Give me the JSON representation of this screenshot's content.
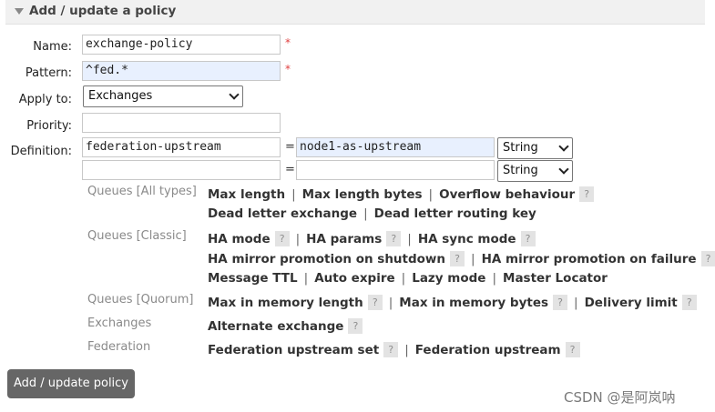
{
  "section": {
    "title": "Add / update a policy"
  },
  "form": {
    "name_label": "Name:",
    "name_value": "exchange-policy",
    "pattern_label": "Pattern:",
    "pattern_value": "^fed.*",
    "apply_to_label": "Apply to:",
    "apply_to_value": "Exchanges",
    "priority_label": "Priority:",
    "priority_value": "",
    "definition_label": "Definition:",
    "required_mark": "*",
    "equals": "=",
    "definitions": [
      {
        "key": "federation-upstream",
        "value": "node1-as-upstream",
        "type": "String"
      },
      {
        "key": "",
        "value": "",
        "type": "String"
      }
    ]
  },
  "help_mark": "?",
  "separator": "|",
  "categories": {
    "queues_all": "Queues [All types]",
    "queues_classic": "Queues [Classic]",
    "queues_quorum": "Queues [Quorum]",
    "exchanges": "Exchanges",
    "federation": "Federation"
  },
  "keys": {
    "max_length": "Max length",
    "max_length_bytes": "Max length bytes",
    "overflow_behaviour": "Overflow behaviour",
    "dead_letter_exchange": "Dead letter exchange",
    "dead_letter_routing_key": "Dead letter routing key",
    "ha_mode": "HA mode",
    "ha_params": "HA params",
    "ha_sync_mode": "HA sync mode",
    "ha_mirror_promotion_on_shutdown": "HA mirror promotion on shutdown",
    "ha_mirror_promotion_on_failure": "HA mirror promotion on failure",
    "message_ttl": "Message TTL",
    "auto_expire": "Auto expire",
    "lazy_mode": "Lazy mode",
    "master_locator": "Master Locator",
    "max_in_memory_length": "Max in memory length",
    "max_in_memory_bytes": "Max in memory bytes",
    "delivery_limit": "Delivery limit",
    "alternate_exchange": "Alternate exchange",
    "federation_upstream_set": "Federation upstream set",
    "federation_upstream": "Federation upstream"
  },
  "submit_label": "Add / update policy",
  "watermark": "CSDN @是阿岚呐"
}
